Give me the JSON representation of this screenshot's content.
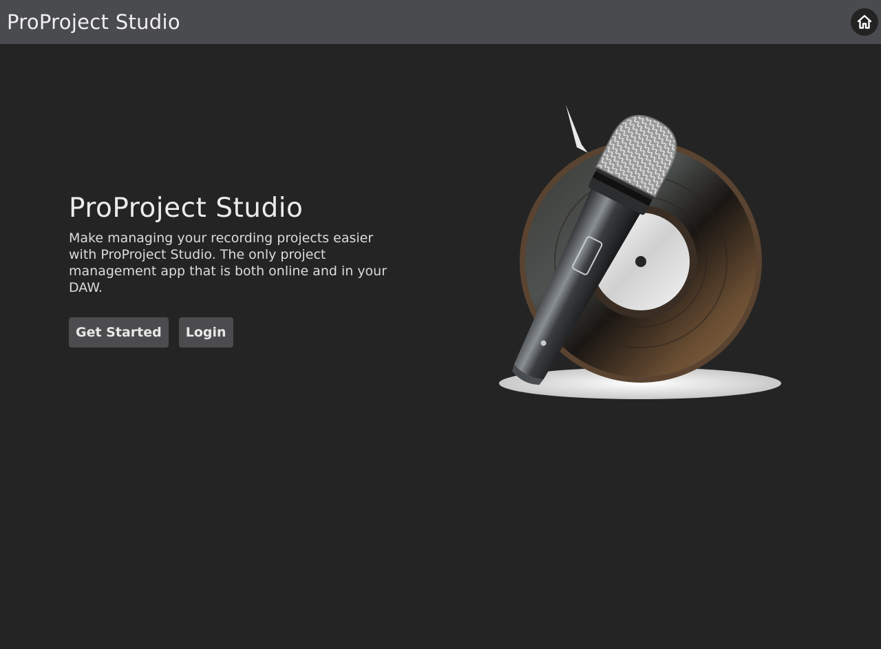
{
  "header": {
    "title": "ProProject Studio",
    "home_icon": "home-icon"
  },
  "hero": {
    "title": "ProProject Studio",
    "description": "Make managing your recording projects easier with ProProject Studio. The only project management app that is both online and in your DAW.",
    "buttons": {
      "get_started": "Get Started",
      "login": "Login"
    }
  },
  "illustration": {
    "subject": "microphone-and-vinyl-record"
  },
  "colors": {
    "background": "#242424",
    "header": "#4a4b4e",
    "button": "#4c4c4e",
    "text": "#e6e6e6"
  }
}
